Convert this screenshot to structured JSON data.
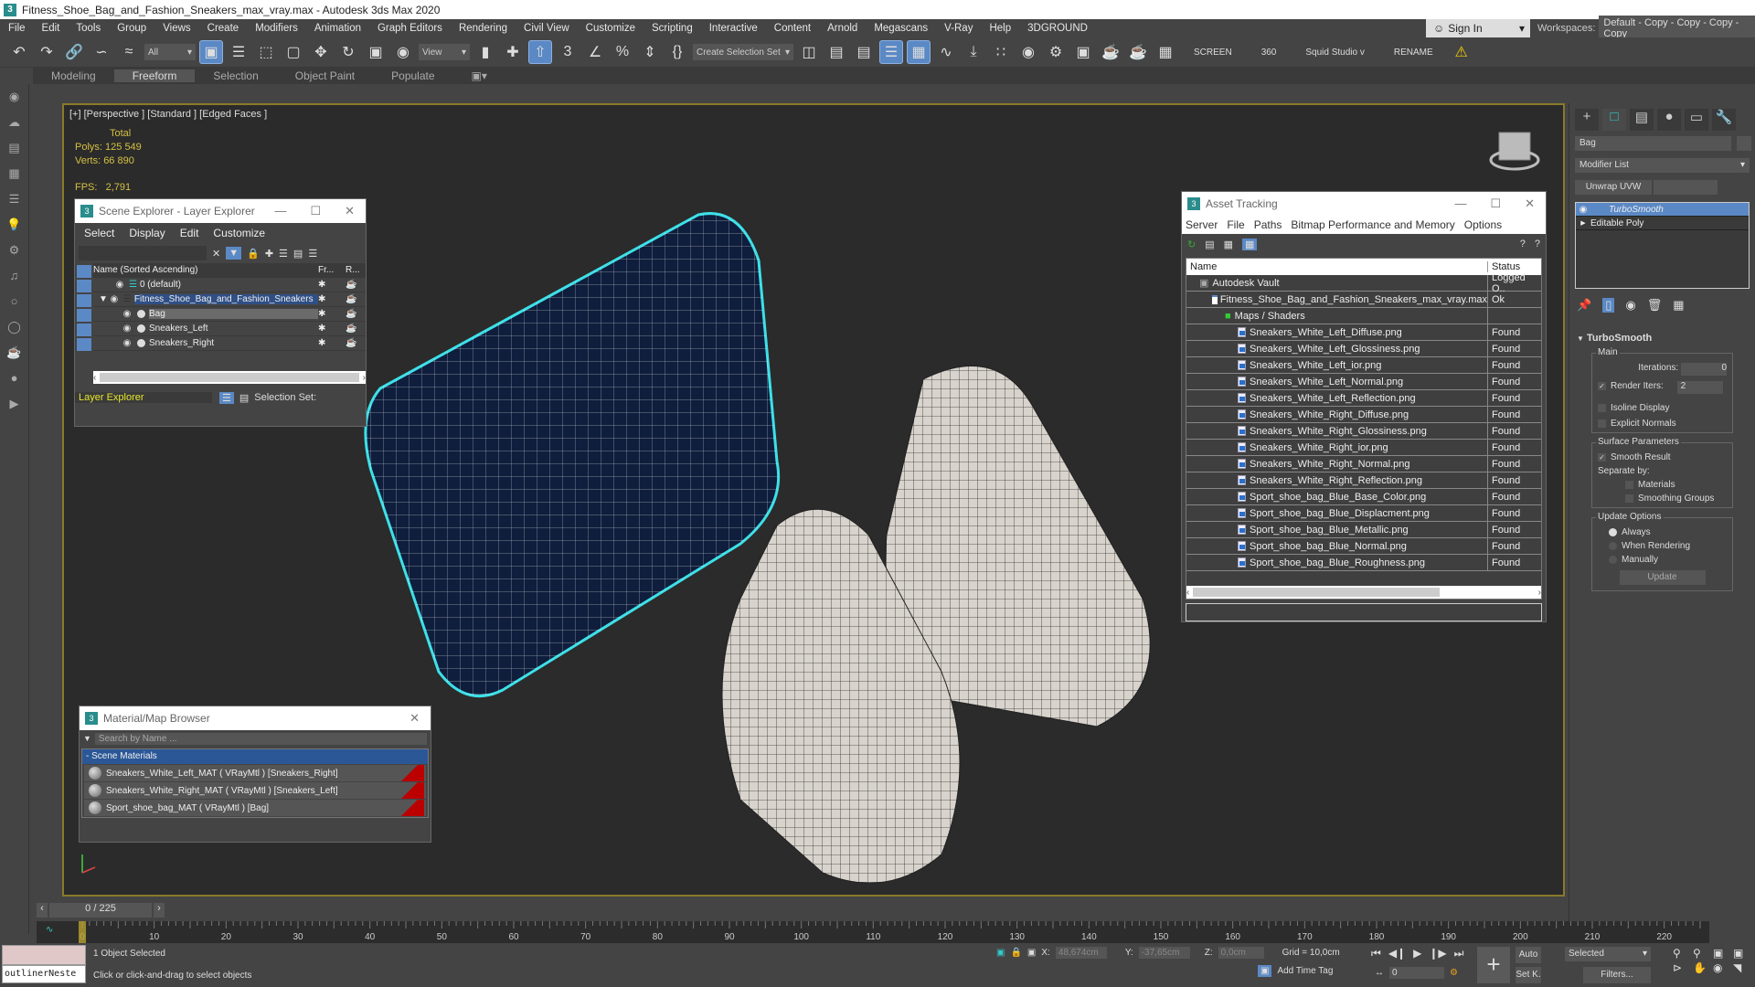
{
  "window": {
    "title": "Fitness_Shoe_Bag_and_Fashion_Sneakers_max_vray.max - Autodesk 3ds Max 2020",
    "app_icon": "3"
  },
  "menu": [
    "File",
    "Edit",
    "Tools",
    "Group",
    "Views",
    "Create",
    "Modifiers",
    "Animation",
    "Graph Editors",
    "Rendering",
    "Civil View",
    "Customize",
    "Scripting",
    "Interactive",
    "Content",
    "Arnold",
    "Megascans",
    "V-Ray",
    "Help",
    "3DGROUND"
  ],
  "account": {
    "sign_in": "Sign In",
    "workspaces_label": "Workspaces:",
    "workspace": "Default - Copy - Copy - Copy - Copy"
  },
  "toolbar": {
    "selection_filter": "All",
    "reference_coord": "View",
    "selection_set": "Create Selection Set",
    "extras": [
      "SCREEN",
      "360",
      "Squid Studio v",
      "RENAME"
    ]
  },
  "ribbon": {
    "tabs": [
      "Modeling",
      "Freeform",
      "Selection",
      "Object Paint",
      "Populate"
    ],
    "active": "Freeform"
  },
  "viewport": {
    "label": "[+] [Perspective ] [Standard ] [Edged Faces ]",
    "stats": {
      "total_label": "Total",
      "polys_label": "Polys:",
      "polys": "125 549",
      "verts_label": "Verts:",
      "verts": "66 890",
      "fps_label": "FPS:",
      "fps": "2,791"
    }
  },
  "scene_explorer": {
    "title": "Scene Explorer - Layer Explorer",
    "menu": [
      "Select",
      "Display",
      "Edit",
      "Customize"
    ],
    "columns": {
      "name": "Name (Sorted Ascending)",
      "freeze": "Fr...",
      "render": "R..."
    },
    "rows": [
      {
        "name": "0 (default)",
        "level": 0
      },
      {
        "name": "Fitness_Shoe_Bag_and_Fashion_Sneakers",
        "level": 0,
        "expanded": true
      },
      {
        "name": "Bag",
        "level": 1,
        "selected": true
      },
      {
        "name": "Sneakers_Left",
        "level": 1
      },
      {
        "name": "Sneakers_Right",
        "level": 1
      }
    ],
    "footer_mode": "Layer Explorer",
    "selection_set_label": "Selection Set:"
  },
  "asset_tracking": {
    "title": "Asset Tracking",
    "menu": [
      "Server",
      "File",
      "Paths",
      "Bitmap Performance and Memory",
      "Options"
    ],
    "columns": [
      "Name",
      "Status"
    ],
    "rows": [
      {
        "name": "Autodesk Vault",
        "status": "Logged O..",
        "level": 0,
        "icon": "vault-icon"
      },
      {
        "name": "Fitness_Shoe_Bag_and_Fashion_Sneakers_max_vray.max",
        "status": "Ok",
        "level": 1,
        "icon": "max-file-icon"
      },
      {
        "name": "Maps / Shaders",
        "status": "",
        "level": 2,
        "icon": "maps-icon"
      },
      {
        "name": "Sneakers_White_Left_Diffuse.png",
        "status": "Found",
        "level": 3
      },
      {
        "name": "Sneakers_White_Left_Glossiness.png",
        "status": "Found",
        "level": 3
      },
      {
        "name": "Sneakers_White_Left_ior.png",
        "status": "Found",
        "level": 3
      },
      {
        "name": "Sneakers_White_Left_Normal.png",
        "status": "Found",
        "level": 3
      },
      {
        "name": "Sneakers_White_Left_Reflection.png",
        "status": "Found",
        "level": 3
      },
      {
        "name": "Sneakers_White_Right_Diffuse.png",
        "status": "Found",
        "level": 3
      },
      {
        "name": "Sneakers_White_Right_Glossiness.png",
        "status": "Found",
        "level": 3
      },
      {
        "name": "Sneakers_White_Right_ior.png",
        "status": "Found",
        "level": 3
      },
      {
        "name": "Sneakers_White_Right_Normal.png",
        "status": "Found",
        "level": 3
      },
      {
        "name": "Sneakers_White_Right_Reflection.png",
        "status": "Found",
        "level": 3
      },
      {
        "name": "Sport_shoe_bag_Blue_Base_Color.png",
        "status": "Found",
        "level": 3
      },
      {
        "name": "Sport_shoe_bag_Blue_Displacment.png",
        "status": "Found",
        "level": 3
      },
      {
        "name": "Sport_shoe_bag_Blue_Metallic.png",
        "status": "Found",
        "level": 3
      },
      {
        "name": "Sport_shoe_bag_Blue_Normal.png",
        "status": "Found",
        "level": 3
      },
      {
        "name": "Sport_shoe_bag_Blue_Roughness.png",
        "status": "Found",
        "level": 3
      }
    ]
  },
  "material_browser": {
    "title": "Material/Map Browser",
    "search_placeholder": "Search by Name ...",
    "group": "- Scene Materials",
    "items": [
      "Sneakers_White_Left_MAT  ( VRayMtl ) [Sneakers_Right]",
      "Sneakers_White_Right_MAT  ( VRayMtl ) [Sneakers_Left]",
      "Sport_shoe_bag_MAT  ( VRayMtl ) [Bag]"
    ]
  },
  "command_panel": {
    "object_name": "Bag",
    "modifier_list": "Modifier List",
    "quick_buttons": [
      "Unwrap UVW",
      ""
    ],
    "stack": [
      {
        "name": "TurboSmooth",
        "active": true
      },
      {
        "name": "Editable Poly",
        "active": false
      }
    ],
    "rollout": {
      "title": "TurboSmooth",
      "main_label": "Main",
      "iterations_label": "Iterations:",
      "iterations": "0",
      "render_iters_label": "Render Iters:",
      "render_iters": "2",
      "render_iters_checked": true,
      "isoline_label": "Isoline Display",
      "isoline_checked": false,
      "explicit_normals_label": "Explicit Normals",
      "explicit_normals_checked": false,
      "surface_label": "Surface Parameters",
      "smooth_result_label": "Smooth Result",
      "smooth_result_checked": true,
      "separate_by_label": "Separate by:",
      "materials_label": "Materials",
      "smoothing_groups_label": "Smoothing Groups",
      "update_label": "Update Options",
      "update_options": [
        "Always",
        "When Rendering",
        "Manually"
      ],
      "update_selected": "Always",
      "update_button": "Update"
    }
  },
  "timeline": {
    "frame_display": "0 / 225",
    "current_frame": 0,
    "total_frames": 225,
    "ticks": [
      "0",
      "10",
      "20",
      "30",
      "40",
      "50",
      "60",
      "70",
      "80",
      "90",
      "100",
      "110",
      "120",
      "130",
      "140",
      "150",
      "160",
      "170",
      "180",
      "190",
      "200",
      "210",
      "220"
    ]
  },
  "status": {
    "script_label": "outlinerNeste",
    "selected": "1 Object Selected",
    "prompt": "Click or click-and-drag to select objects",
    "x_label": "X:",
    "x": "48,674cm",
    "y_label": "Y:",
    "y": "-37,65cm",
    "z_label": "Z:",
    "z": "0,0cm",
    "grid": "Grid = 10,0cm",
    "add_time_tag": "Add Time Tag",
    "frame_field": "0",
    "auto": "Auto",
    "set_key": "Set K.",
    "key_filter": "Selected",
    "filters": "Filters..."
  }
}
